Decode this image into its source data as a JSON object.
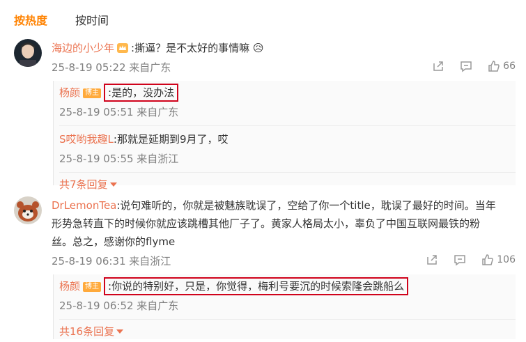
{
  "tabs": {
    "hot": "按热度",
    "time": "按时间"
  },
  "c1": {
    "user": "海边的小少年",
    "text": ":撕逼？是不太好的事情嘛 😥",
    "meta": "25-8-19 05:22 来自广东",
    "likes": "66",
    "replies": [
      {
        "user": "杨颜",
        "badge": "博主",
        "text": ":是的，没办法",
        "meta": "25-8-19 05:51 来自广东"
      },
      {
        "user": "S哎哟我趣L",
        "text": ":那就是延期到9月了，哎",
        "meta": "25-8-19 05:55 来自浙江"
      }
    ],
    "more": "共7条回复"
  },
  "c2": {
    "user": "DrLemonTea",
    "text1": ":说句难听的，你就是被魅族耽误了，空给了你一个title，耽误了最好的时间。当年",
    "text2": "形势急转直下的时候你就应该跳槽其他厂子了。黄家人格局太小，辜负了中国互联网最铁的粉",
    "text3": "丝。总之，感谢你的flyme",
    "meta": "25-8-19 06:31 来自浙江",
    "likes": "106",
    "replies": [
      {
        "user": "杨颜",
        "badge": "博主",
        "text": ":你说的特别好，只是，你觉得，梅利号要沉的时候索隆会跳船么",
        "meta": "25-8-19 06:52 来自广东"
      }
    ],
    "more": "共16条回复"
  }
}
